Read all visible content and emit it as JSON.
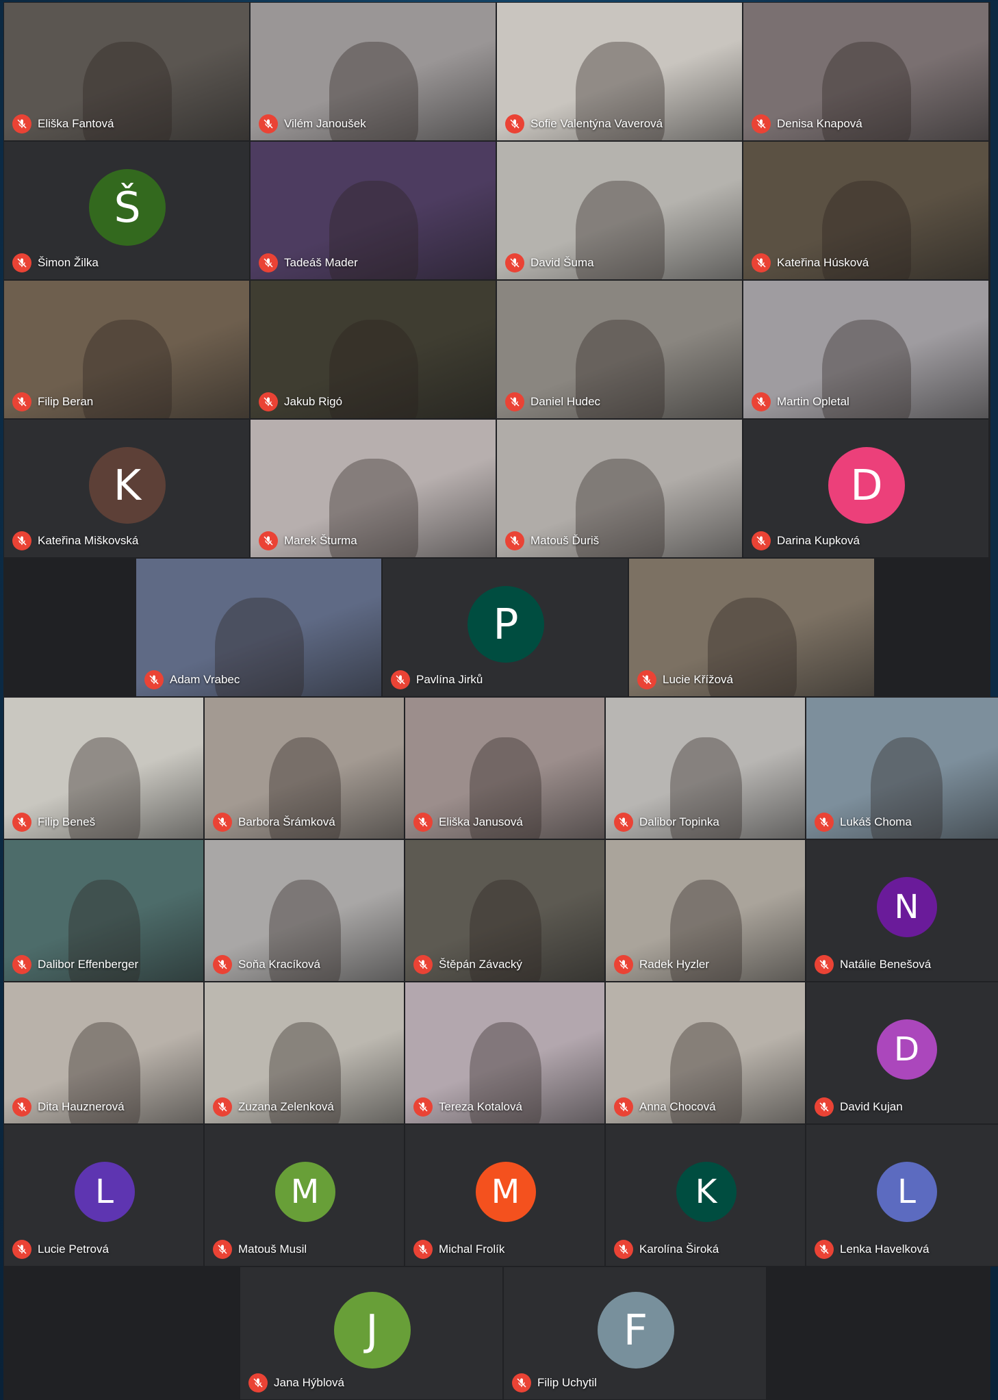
{
  "meeting": {
    "colors": {
      "muted_red": "#ea4335",
      "tile_bg": "#3c4043",
      "grid_bg": "#202124"
    },
    "participants": [
      {
        "name": "Eliška Fantová",
        "muted": true,
        "tile": "video",
        "bg": "#5b5651"
      },
      {
        "name": "Vilém Janoušek",
        "muted": true,
        "tile": "video",
        "bg": "#9a9696"
      },
      {
        "name": "Sofie Valentýna Vaverová",
        "muted": true,
        "tile": "video",
        "bg": "#c9c5bf"
      },
      {
        "name": "Denisa Knapová",
        "muted": true,
        "tile": "video",
        "bg": "#7a7071"
      },
      {
        "name": "Šimon Žilka",
        "muted": true,
        "tile": "avatar",
        "initial": "Š",
        "avatar_color": "#33691e"
      },
      {
        "name": "Tadeáš Mader",
        "muted": true,
        "tile": "video",
        "bg": "#4d3c60"
      },
      {
        "name": "David Šuma",
        "muted": true,
        "tile": "video",
        "bg": "#b5b3ae"
      },
      {
        "name": "Kateřina Húsková",
        "muted": true,
        "tile": "video",
        "bg": "#5b5143"
      },
      {
        "name": "Filip Beran",
        "muted": true,
        "tile": "video",
        "bg": "#6e5f4e"
      },
      {
        "name": "Jakub Rigó",
        "muted": true,
        "tile": "video",
        "bg": "#3f3d31"
      },
      {
        "name": "Daniel Hudec",
        "muted": true,
        "tile": "video",
        "bg": "#8a8680"
      },
      {
        "name": "Martin Opletal",
        "muted": true,
        "tile": "video",
        "bg": "#9f9ca0"
      },
      {
        "name": "Kateřina Miškovská",
        "muted": true,
        "tile": "avatar",
        "initial": "K",
        "avatar_color": "#5d4037"
      },
      {
        "name": "Marek Šturma",
        "muted": true,
        "tile": "video",
        "bg": "#b7afae"
      },
      {
        "name": "Matouš Ďuriš",
        "muted": true,
        "tile": "video",
        "bg": "#b0aca8"
      },
      {
        "name": "Darina Kupková",
        "muted": true,
        "tile": "avatar",
        "initial": "D",
        "avatar_color": "#ec407a"
      },
      {
        "name": "Adam Vrabec",
        "muted": true,
        "tile": "video",
        "bg": "#5f6a85"
      },
      {
        "name": "Pavlína Jirků",
        "muted": true,
        "tile": "avatar",
        "initial": "P",
        "avatar_color": "#004d40"
      },
      {
        "name": "Lucie Křížová",
        "muted": true,
        "tile": "video",
        "bg": "#7c7163"
      },
      {
        "name": "Filip Beneš",
        "muted": true,
        "tile": "video",
        "bg": "#c9c7c0"
      },
      {
        "name": "Barbora Šrámková",
        "muted": true,
        "tile": "video",
        "bg": "#a39a92"
      },
      {
        "name": "Eliška Janusová",
        "muted": true,
        "tile": "video",
        "bg": "#9c8e8c"
      },
      {
        "name": "Dalibor Topinka",
        "muted": true,
        "tile": "video",
        "bg": "#b8b6b3"
      },
      {
        "name": "Lukáš Choma",
        "muted": true,
        "tile": "video",
        "bg": "#7d8f9c"
      },
      {
        "name": "Dalibor Effenberger",
        "muted": true,
        "tile": "video",
        "bg": "#4d6c6a"
      },
      {
        "name": "Soňa Kracíková",
        "muted": true,
        "tile": "video",
        "bg": "#a9a7a6"
      },
      {
        "name": "Štěpán Závacký",
        "muted": true,
        "tile": "video",
        "bg": "#5d5a52"
      },
      {
        "name": "Radek Hyzler",
        "muted": true,
        "tile": "video",
        "bg": "#aaa49b"
      },
      {
        "name": "Natálie Benešová",
        "muted": true,
        "tile": "avatar",
        "initial": "N",
        "avatar_color": "#6a1b9a"
      },
      {
        "name": "Dita Hauznerová",
        "muted": true,
        "tile": "video",
        "bg": "#b9b2aa"
      },
      {
        "name": "Zuzana Zelenková",
        "muted": true,
        "tile": "video",
        "bg": "#bcb8b0"
      },
      {
        "name": "Tereza Kotalová",
        "muted": true,
        "tile": "video",
        "bg": "#b3a7ae"
      },
      {
        "name": "Anna Chocová",
        "muted": true,
        "tile": "video",
        "bg": "#b8b2aa"
      },
      {
        "name": "David Kujan",
        "muted": true,
        "tile": "avatar",
        "initial": "D",
        "avatar_color": "#ab47bc"
      },
      {
        "name": "Lucie Petrová",
        "muted": true,
        "tile": "avatar",
        "initial": "L",
        "avatar_color": "#5e35b1"
      },
      {
        "name": "Matouš Musil",
        "muted": true,
        "tile": "avatar",
        "initial": "M",
        "avatar_color": "#689f38"
      },
      {
        "name": "Michal Frolík",
        "muted": true,
        "tile": "avatar",
        "initial": "M",
        "avatar_color": "#f4511e"
      },
      {
        "name": "Karolína Široká",
        "muted": true,
        "tile": "avatar",
        "initial": "K",
        "avatar_color": "#004d40"
      },
      {
        "name": "Lenka Havelková",
        "muted": true,
        "tile": "avatar",
        "initial": "L",
        "avatar_color": "#5c6bc0"
      },
      {
        "name": "Jana Hýblová",
        "muted": true,
        "tile": "avatar",
        "initial": "J",
        "avatar_color": "#689f38"
      },
      {
        "name": "Filip Uchytil",
        "muted": true,
        "tile": "avatar",
        "initial": "F",
        "avatar_color": "#78909c"
      }
    ]
  }
}
